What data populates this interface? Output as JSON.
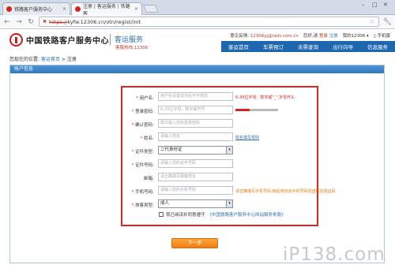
{
  "browser": {
    "tabs": [
      {
        "title": "铁路客户服务中心"
      },
      {
        "title": "注册 | 客运服务 | 铁路客"
      }
    ],
    "omnibox": {
      "scheme": "https://",
      "host": "kyfw.12306.cn",
      "path": "/otn/regist/init"
    }
  },
  "header": {
    "site_name": "中国铁路客户服务中心",
    "sub_name": "客运服务",
    "hotline": "客服热线:12306",
    "top_links": {
      "feedback_label": "意见反馈:",
      "feedback_email": "12306yj@rails.com.cn",
      "greeting": "您好,请",
      "login": "登录",
      "register": "注册",
      "my12306": "我的12306 ▾",
      "mobile": "手机版"
    },
    "nav": [
      "客运首页",
      "车票预订",
      "余票查询",
      "出行向导",
      "信息服务"
    ]
  },
  "breadcrumb": {
    "prefix": "您现在的位置:",
    "home": "客运首页",
    "current": "> 注册"
  },
  "panel": {
    "title": "账户信息"
  },
  "form": {
    "fields": [
      {
        "label": "用户名:",
        "placeholder": "用户名设置成功后不可修改",
        "hint": "6-30位字母、数字或\"_\",字母开头"
      },
      {
        "label": "登录密码:",
        "placeholder": "6-20位字母、数字或符号"
      },
      {
        "label": "确认密码:",
        "placeholder": "再次输入您的登录密码"
      },
      {
        "label": "姓名:",
        "placeholder": "请输入姓名",
        "hint": "姓名填写规则"
      },
      {
        "label": "证件类型:",
        "value": "二代身份证"
      },
      {
        "label": "证件号码:",
        "placeholder": "请输入您的证件号码"
      },
      {
        "label": "邮箱:",
        "placeholder": "请正确填写邮箱地址"
      },
      {
        "label": "手机号码:",
        "placeholder": "请输入您的手机号码",
        "hint": "请正确填写手机号码,稍后将向该手机号码发送短信验证码"
      },
      {
        "label": "旅客类型:",
        "value": "成人"
      }
    ],
    "agreement": {
      "text": "我已阅读并同意遵守",
      "link": "《中国铁路客户服务中心网站服务条款》"
    },
    "next_label": "下一步"
  },
  "watermark": "iP138.com",
  "colors": {
    "accent": "#1e67b0",
    "required": "#d8241f",
    "button": "#f07e10",
    "highlight_box": "#e02424"
  }
}
